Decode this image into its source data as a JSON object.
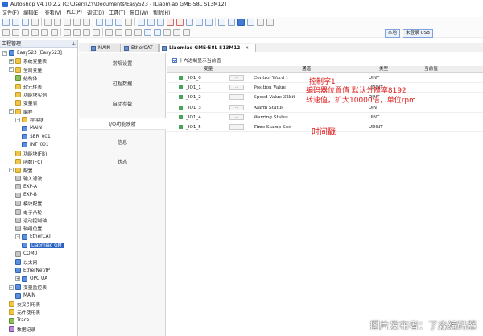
{
  "window": {
    "title": "AutoShop V4.10.2.2 [C:\\Users\\ZY\\Documents\\Easy523 - [Liaomiao GME-58L S13M12]"
  },
  "menu": [
    "文件(F)",
    "编辑(E)",
    "查看(V)",
    "PLC(P)",
    "调试(D)",
    "工具(T)",
    "窗口(W)",
    "帮助(H)"
  ],
  "toolbar": {
    "buttons": [
      "本地",
      "未登录 USB"
    ]
  },
  "project_panel": {
    "title": "工程管理",
    "tree": [
      {
        "label": "Easy523 [Easy523]",
        "icon": "project-icon",
        "expander": "-"
      },
      {
        "label": "系统变量表",
        "icon": "table-icon",
        "expander": "+"
      },
      {
        "label": "全局变量",
        "icon": "table-icon",
        "expander": "-"
      },
      {
        "label": "结构体",
        "icon": "struct-icon",
        "expander": ""
      },
      {
        "label": "软元件表",
        "icon": "table-icon",
        "expander": ""
      },
      {
        "label": "功能块实例",
        "icon": "block-icon",
        "expander": ""
      },
      {
        "label": "变量表",
        "icon": "table-icon",
        "expander": ""
      },
      {
        "label": "编程",
        "icon": "folder-icon",
        "expander": "-"
      },
      {
        "label": "程序块",
        "icon": "folder-icon",
        "expander": "-"
      },
      {
        "label": "MAIN",
        "icon": "program-icon",
        "expander": ""
      },
      {
        "label": "SBR_001",
        "icon": "program-icon",
        "expander": ""
      },
      {
        "label": "INT_001",
        "icon": "program-icon",
        "expander": ""
      },
      {
        "label": "功能块(FB)",
        "icon": "block-icon",
        "expander": ""
      },
      {
        "label": "函数(FC)",
        "icon": "block-icon",
        "expander": ""
      },
      {
        "label": "配置",
        "icon": "folder-icon",
        "expander": "-"
      },
      {
        "label": "输入滤波",
        "icon": "config-icon",
        "expander": ""
      },
      {
        "label": "EXP-A",
        "icon": "config-icon",
        "expander": ""
      },
      {
        "label": "EXP-B",
        "icon": "config-icon",
        "expander": ""
      },
      {
        "label": "模块配置",
        "icon": "config-icon",
        "expander": ""
      },
      {
        "label": "电子凸轮",
        "icon": "config-icon",
        "expander": ""
      },
      {
        "label": "运动控制轴",
        "icon": "config-icon",
        "expander": ""
      },
      {
        "label": "轴组位置",
        "icon": "config-icon",
        "expander": ""
      },
      {
        "label": "EtherCAT",
        "icon": "network-icon",
        "expander": "-"
      },
      {
        "label": "Liaomiao GM",
        "icon": "device-icon",
        "expander": ""
      },
      {
        "label": "COM0",
        "icon": "port-icon",
        "expander": ""
      },
      {
        "label": "以太网",
        "icon": "network-icon",
        "expander": ""
      },
      {
        "label": "EtherNet/IP",
        "icon": "network-icon",
        "expander": ""
      },
      {
        "label": "OPC UA",
        "icon": "network-icon",
        "expander": "+"
      },
      {
        "label": "变量监控表",
        "icon": "monitor-icon",
        "expander": "-"
      },
      {
        "label": "MAIN",
        "icon": "monitor-icon",
        "expander": ""
      },
      {
        "label": "交叉引用表",
        "icon": "table-icon",
        "expander": ""
      },
      {
        "label": "元件使用表",
        "icon": "table-icon",
        "expander": ""
      },
      {
        "label": "Trace",
        "icon": "trace-icon",
        "expander": ""
      },
      {
        "label": "数据记录",
        "icon": "record-icon",
        "expander": ""
      }
    ]
  },
  "tabs": [
    {
      "label": "MAIN",
      "active": false
    },
    {
      "label": "EtherCAT",
      "active": false
    },
    {
      "label": "Liaomiao GME-58L S13M12",
      "active": true,
      "close": "×"
    }
  ],
  "config_nav": [
    {
      "label": "常规设置",
      "active": false
    },
    {
      "label": "过程数据",
      "active": false
    },
    {
      "label": "启动参数",
      "active": false
    },
    {
      "label": "I/O功能映射",
      "active": true
    },
    {
      "label": "信息",
      "active": false
    },
    {
      "label": "状态",
      "active": false
    }
  ],
  "io_mapping": {
    "hex_checkbox_label": "十六进制显示当前值",
    "hex_checked": true,
    "columns": [
      "变量",
      "通道",
      "类型",
      "当前值"
    ],
    "rows": [
      {
        "variable": "_IQ1_0",
        "button": "...",
        "channel": "Control Word 1",
        "type": "UINT",
        "value": ""
      },
      {
        "variable": "_IQ1_1",
        "button": "...",
        "channel": "Position Value",
        "type": "UDINT",
        "value": ""
      },
      {
        "variable": "_IQ1_2",
        "button": "...",
        "channel": "Speed Value 32bit",
        "type": "DINT",
        "value": ""
      },
      {
        "variable": "_IQ1_3",
        "button": "...",
        "channel": "Alarm Status",
        "type": "UINT",
        "value": ""
      },
      {
        "variable": "_IQ1_4",
        "button": "...",
        "channel": "Warring Status",
        "type": "UINT",
        "value": ""
      },
      {
        "variable": "_IQ1_5",
        "button": "...",
        "channel": "Time Stamp Sec",
        "type": "UDINT",
        "value": ""
      }
    ]
  },
  "annotations": [
    "控制字1",
    "编码器位置值 默认分辨率8192",
    "转速值，扩大10000倍，单位rpm",
    "时间戳"
  ],
  "watermark": "图片发布者：了淼编码器",
  "colors": {
    "annotation": "#e02020",
    "selected": "#2a63c2"
  }
}
